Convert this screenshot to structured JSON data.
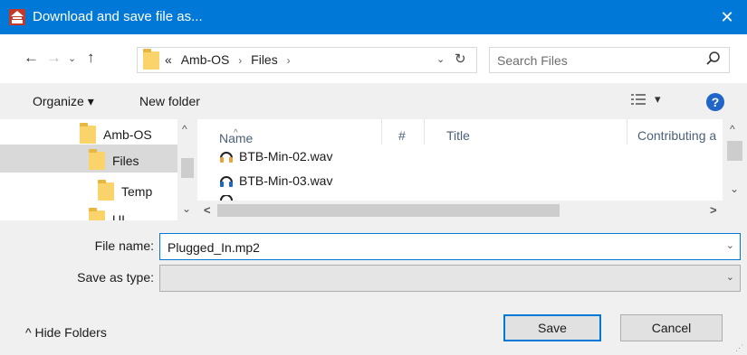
{
  "window": {
    "title": "Download and save file as...",
    "close": "✕"
  },
  "nav": {
    "back": "←",
    "forward": "→",
    "recent": "⌄",
    "up": "↑",
    "refresh": "↻",
    "addr_dropdown": "⌄"
  },
  "address": {
    "overflow": "«",
    "crumbs": [
      "Amb-OS",
      "Files"
    ],
    "separator": "›"
  },
  "search": {
    "placeholder": "Search Files"
  },
  "toolbar": {
    "organize": "Organize ▾",
    "new_folder": "New folder",
    "view_dd": "▾",
    "help": "?"
  },
  "tree": {
    "items": [
      {
        "label": "Amb-OS",
        "indent": 1
      },
      {
        "label": "Files",
        "indent": 2,
        "selected": true
      },
      {
        "label": "Temp",
        "indent": 3
      },
      {
        "label": "UI",
        "indent": 1
      }
    ],
    "scroll_up": "^",
    "scroll_down": "⌄"
  },
  "filelist": {
    "columns": [
      "Name",
      "#",
      "Title",
      "Contributing a"
    ],
    "sort_glyph": "^",
    "files": [
      {
        "name": "BTB-Min-02.wav"
      },
      {
        "name": "BTB-Min-03.wav"
      }
    ],
    "scroll_up": "^",
    "scroll_down": "⌄",
    "scroll_left": "<",
    "scroll_right": ">"
  },
  "form": {
    "filename_label": "File name:",
    "filename_value": "Plugged_In.mp2",
    "savetype_label": "Save as type:",
    "savetype_value": "",
    "hide_folders": "^  Hide Folders",
    "save": "Save",
    "cancel": "Cancel",
    "dd": "⌄"
  },
  "colors": {
    "accent": "#0078d7",
    "folder": "#fbd36b",
    "header_text": "#4c607a"
  }
}
